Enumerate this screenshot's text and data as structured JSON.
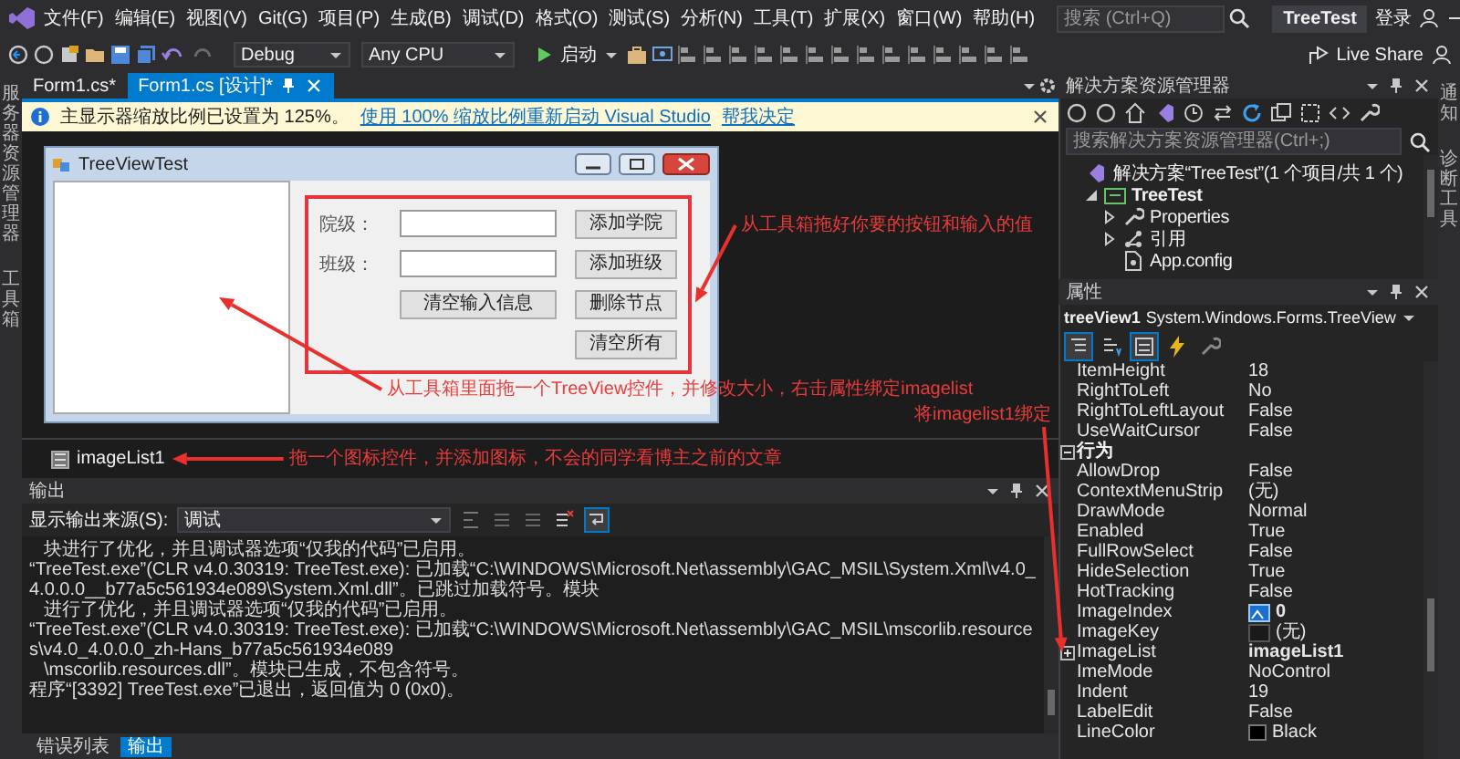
{
  "window": {
    "title": "TreeTest"
  },
  "menu": [
    "文件(F)",
    "编辑(E)",
    "视图(V)",
    "Git(G)",
    "项目(P)",
    "生成(B)",
    "调试(D)",
    "格式(O)",
    "测试(S)",
    "分析(N)",
    "工具(T)",
    "扩展(X)",
    "窗口(W)",
    "帮助(H)"
  ],
  "search": {
    "placeholder": "搜索 (Ctrl+Q)"
  },
  "account": {
    "label": "登录"
  },
  "toolbar": {
    "configuration": "Debug",
    "platform": "Any CPU",
    "start": "启动",
    "live_share": "Live Share"
  },
  "left_rail": [
    "服务器资源管理器",
    "工具箱"
  ],
  "right_rail": [
    "通知",
    "诊断工具"
  ],
  "document_tabs": [
    {
      "label": "Form1.cs*",
      "selected": false
    },
    {
      "label": "Form1.cs [设计]*",
      "selected": true
    }
  ],
  "info_bar": {
    "message": "主显示器缩放比例已设置为 125%。",
    "links": [
      "使用 100% 缩放比例重新启动 Visual Studio",
      "帮我决定"
    ]
  },
  "designer": {
    "form": {
      "title": "TreeViewTest",
      "fields": [
        {
          "label": "院级："
        },
        {
          "label": "班级："
        }
      ],
      "clear_button": "清空输入信息",
      "buttons": [
        "添加学院",
        "添加班级",
        "删除节点",
        "清空所有"
      ]
    },
    "tray": [
      {
        "label": "imageList1"
      }
    ],
    "annotations": [
      {
        "text": "从工具箱拖好你要的按钮和输入的值",
        "kind": "controls"
      },
      {
        "text": "从工具箱里面拖一个TreeView控件，并修改大小，右击属性绑定imagelist",
        "kind": "tree_view"
      },
      {
        "text": "将imagelist1绑定",
        "kind": "property"
      },
      {
        "text": "拖一个图标控件，并添加图标，不会的同学看博主之前的文章",
        "kind": "tray_item"
      }
    ]
  },
  "output": {
    "title": "输出",
    "source_label": "显示输出来源(S):",
    "source": "调试",
    "lines": [
      {
        "text": "块进行了优化，并且调试器选项“仅我的代码”已启用。",
        "continuation": true
      },
      {
        "text": "“TreeTest.exe”(CLR v4.0.30319: TreeTest.exe): 已加载“C:\\WINDOWS\\Microsoft.Net\\assembly\\GAC_MSIL\\System.Xml\\v4.0_4.0.0.0__b77a5c561934e089\\System.Xml.dll”。已跳过加载符号。模块",
        "continuation": false
      },
      {
        "text": "进行了优化，并且调试器选项“仅我的代码”已启用。",
        "continuation": true
      },
      {
        "text": "“TreeTest.exe”(CLR v4.0.30319: TreeTest.exe): 已加载“C:\\WINDOWS\\Microsoft.Net\\assembly\\GAC_MSIL\\mscorlib.resources\\v4.0_4.0.0.0_zh-Hans_b77a5c561934e089",
        "continuation": false
      },
      {
        "text": "\\mscorlib.resources.dll”。模块已生成，不包含符号。",
        "continuation": true
      },
      {
        "text": "程序“[3392] TreeTest.exe”已退出，返回值为 0 (0x0)。",
        "continuation": false
      }
    ]
  },
  "bottom_tabs": [
    {
      "label": "错误列表",
      "selected": false
    },
    {
      "label": "输出",
      "selected": true
    }
  ],
  "solution_explorer": {
    "title": "解决方案资源管理器",
    "search": {
      "placeholder": "搜索解决方案资源管理器(Ctrl+;)"
    },
    "tree": [
      {
        "label": "解决方案“TreeTest”(1 个项目/共 1 个)",
        "kind": "solution",
        "children": [
          {
            "label": "TreeTest",
            "kind": "project",
            "expanded": true,
            "children": [
              {
                "label": "Properties",
                "kind": "properties",
                "expanded": false
              },
              {
                "label": "引用",
                "kind": "references",
                "expanded": false
              },
              {
                "label": "App.config",
                "kind": "config"
              }
            ]
          }
        ]
      }
    ]
  },
  "properties": {
    "title": "属性",
    "object": {
      "name": "treeView1",
      "type": "System.Windows.Forms.TreeView"
    },
    "view_buttons": [
      {
        "kind": "categorized",
        "selected": true
      },
      {
        "kind": "alphabetical",
        "selected": false
      },
      {
        "kind": "properties",
        "selected": true
      },
      {
        "kind": "events",
        "selected": false
      },
      {
        "kind": "pages",
        "selected": false
      }
    ],
    "rows": [
      {
        "kind": "property",
        "name": "ItemHeight",
        "value": "18",
        "modified": false
      },
      {
        "kind": "property",
        "name": "RightToLeft",
        "value": "No",
        "modified": false
      },
      {
        "kind": "property",
        "name": "RightToLeftLayout",
        "value": "False",
        "modified": false
      },
      {
        "kind": "property",
        "name": "UseWaitCursor",
        "value": "False",
        "modified": false
      },
      {
        "kind": "category",
        "name": "行为",
        "expanded": true,
        "children": [
          {
            "kind": "property",
            "name": "AllowDrop",
            "value": "False",
            "modified": false
          },
          {
            "kind": "property",
            "name": "ContextMenuStrip",
            "value": "(无)",
            "modified": false
          },
          {
            "kind": "property",
            "name": "DrawMode",
            "value": "Normal",
            "modified": false
          },
          {
            "kind": "property",
            "name": "Enabled",
            "value": "True",
            "modified": false
          },
          {
            "kind": "property",
            "name": "FullRowSelect",
            "value": "False",
            "modified": false
          },
          {
            "kind": "property",
            "name": "HideSelection",
            "value": "True",
            "modified": false
          },
          {
            "kind": "property",
            "name": "HotTracking",
            "value": "False",
            "modified": false
          },
          {
            "kind": "image_property",
            "name": "ImageIndex",
            "value": "0",
            "modified": true
          },
          {
            "kind": "empty_image_property",
            "name": "ImageKey",
            "value": "(无)",
            "modified": false
          },
          {
            "kind": "property",
            "name": "ImageList",
            "value": "imageList1",
            "modified": true,
            "expanded": false,
            "pointed_at": true
          },
          {
            "kind": "property",
            "name": "ImeMode",
            "value": "NoControl",
            "modified": false
          },
          {
            "kind": "property",
            "name": "Indent",
            "value": "19",
            "modified": false
          },
          {
            "kind": "property",
            "name": "LabelEdit",
            "value": "False",
            "modified": false
          },
          {
            "kind": "color_property",
            "name": "LineColor",
            "value": "Black",
            "modified": false,
            "color": "#000000"
          }
        ]
      }
    ]
  }
}
